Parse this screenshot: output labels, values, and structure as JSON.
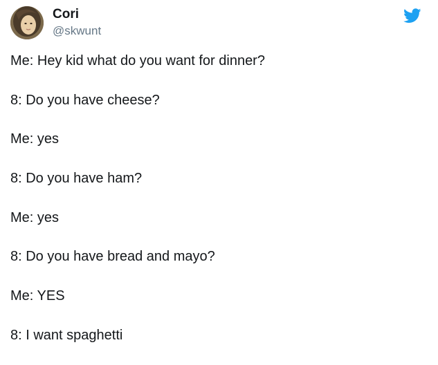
{
  "user": {
    "name": "Cori",
    "handle": "@skwunt"
  },
  "icons": {
    "avatar": "profile-photo",
    "platform": "twitter-bird-icon",
    "brand_color": "#1da1f2"
  },
  "tweet": {
    "lines": [
      "Me: Hey kid what do you want for dinner?",
      "8: Do you have cheese?",
      "Me: yes",
      "8: Do you have ham?",
      "Me: yes",
      "8: Do you have bread and mayo?",
      "Me: YES",
      "8: I want spaghetti"
    ]
  }
}
